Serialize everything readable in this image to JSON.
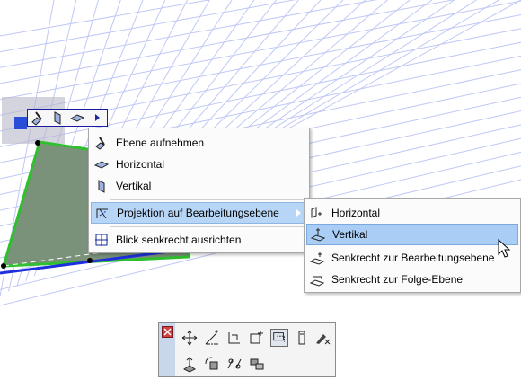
{
  "context_menu": {
    "items": [
      {
        "label": "Ebene aufnehmen",
        "icon": "pick-plane-icon"
      },
      {
        "label": "Horizontal",
        "icon": "horizontal-plane-icon"
      },
      {
        "label": "Vertikal",
        "icon": "vertical-plane-icon"
      },
      {
        "label": "Projektion auf Bearbeitungsebene",
        "icon": "projection-icon",
        "has_submenu": true
      },
      {
        "label": "Blick senkrecht ausrichten",
        "icon": "view-perpendicular-icon"
      }
    ]
  },
  "submenu": {
    "items": [
      {
        "label": "Horizontal",
        "icon": "horizontal-projection-icon"
      },
      {
        "label": "Vertikal",
        "icon": "vertical-projection-icon"
      },
      {
        "label": "Senkrecht zur Bearbeitungsebene",
        "icon": "perpendicular-editing-plane-icon"
      },
      {
        "label": "Senkrecht zur Folge-Ebene",
        "icon": "perpendicular-follow-plane-icon"
      }
    ]
  },
  "mini_toolbar": {
    "buttons": [
      "pick-plane-icon",
      "vertical-plane-icon",
      "horizontal-plane-icon",
      "expand-arrow-icon"
    ]
  },
  "palette": {
    "row1": [
      "move-icon",
      "rotate-icon",
      "offset-icon",
      "add-node-icon",
      "projection-icon",
      "elevation-icon",
      "custom-edit-icon"
    ],
    "row2": [
      "drag-copy-icon",
      "rotate-copy-icon",
      "mirror-icon",
      "multiply-icon"
    ]
  },
  "colors": {
    "highlight": "#b7d6f7",
    "grid": "#b9c3f4",
    "shape_fill": "#6f8f6f",
    "edge_green": "#2fbf2f",
    "edge_blue": "#1f2fdc"
  }
}
